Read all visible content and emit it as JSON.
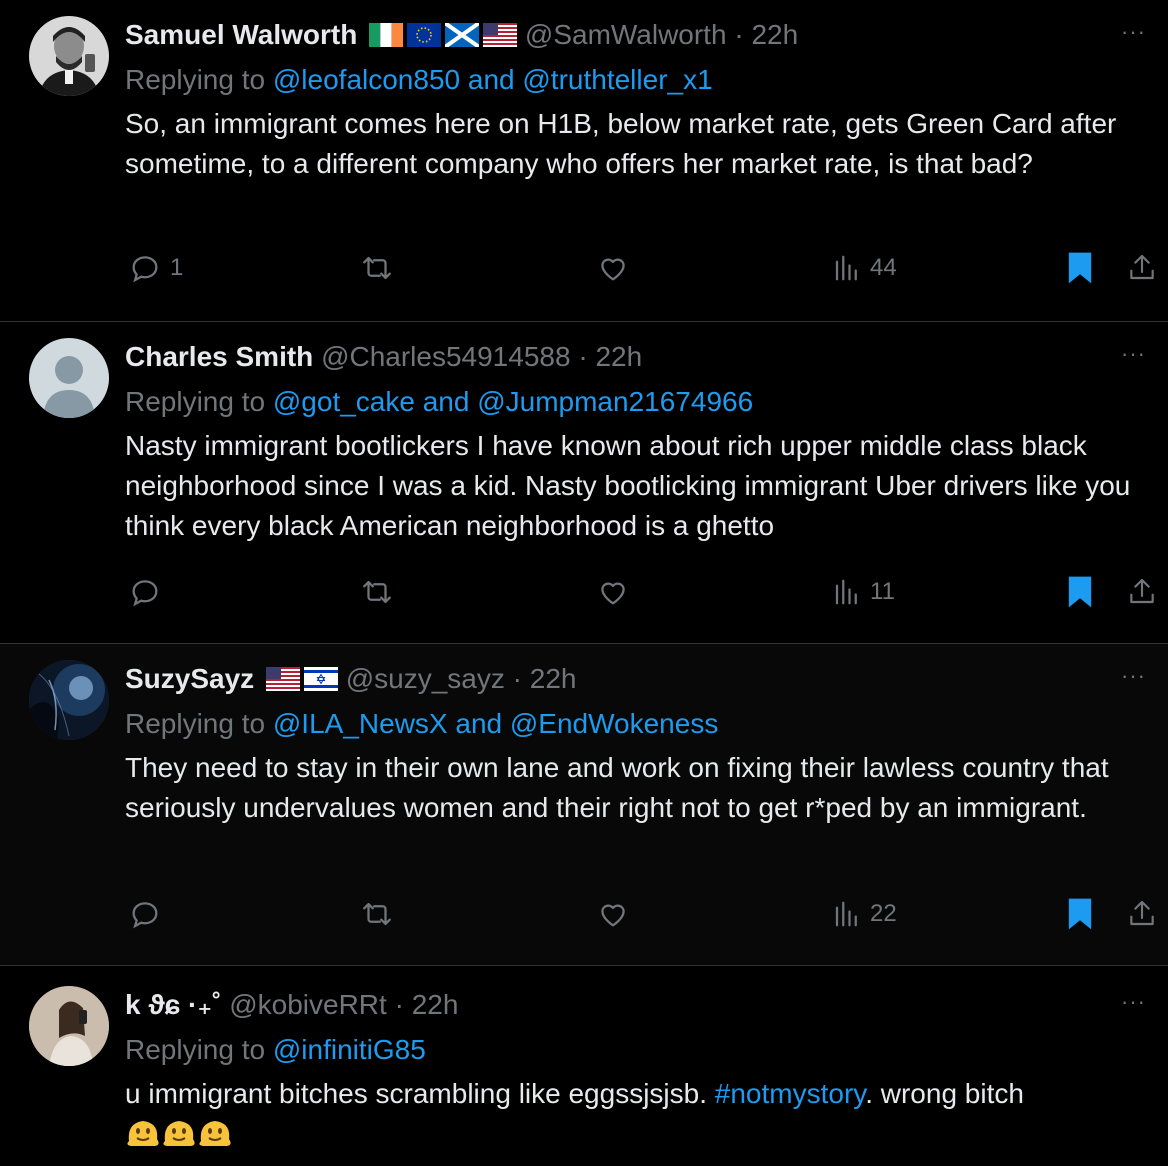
{
  "tweets": [
    {
      "name": "Samuel Walworth",
      "flags": [
        "ireland",
        "eu",
        "scotland",
        "usa"
      ],
      "handle": "@SamWalworth",
      "dot": "·",
      "time": "22h",
      "replying_prefix": "Replying to ",
      "replying_to": "@leofalcon850 and @truthteller_x1",
      "text": "So, an immigrant comes here on H1B, below market rate, gets Green Card after sometime, to a different company who offers her market rate, is that bad?",
      "reply_count": "1",
      "views": "44",
      "more": "···"
    },
    {
      "name": "Charles Smith",
      "flags": [],
      "handle": "@Charles54914588",
      "dot": "·",
      "time": "22h",
      "replying_prefix": "Replying to ",
      "replying_to": "@got_cake and @Jumpman21674966",
      "text": "Nasty immigrant bootlickers I have known about rich upper middle class black neighborhood since I was a kid. Nasty bootlicking immigrant Uber drivers like you think every black American neighborhood is a ghetto",
      "reply_count": "",
      "views": "11",
      "more": "···"
    },
    {
      "name": "SuzySayz",
      "flags": [
        "usa",
        "israel"
      ],
      "handle": "@suzy_sayz",
      "dot": "·",
      "time": "22h",
      "replying_prefix": "Replying to ",
      "replying_to": "@ILA_NewsX and @EndWokeness",
      "text": "They need to stay in their own lane and work on fixing their lawless country that seriously undervalues women and their right not to get r*ped by an immigrant.",
      "reply_count": "",
      "views": "22",
      "more": "···"
    },
    {
      "name": "k ϑɕ ·₊˚",
      "flags": [],
      "handle": "@kobiveRRt",
      "dot": "·",
      "time": "22h",
      "replying_prefix": "Replying to ",
      "replying_to": "@infinitiG85",
      "text_before": "u immigrant bitches scrambling like eggssjsjsb. ",
      "hashtag": "#notmystory",
      "text_after": ". wrong bitch",
      "emoji_count": 3,
      "more": "···"
    }
  ],
  "colors": {
    "background": "#000000",
    "text": "#e7e9ea",
    "muted": "#71767b",
    "accent": "#1d9bf0",
    "divider": "#2f3336"
  },
  "icons": [
    "reply-icon",
    "retweet-icon",
    "like-icon",
    "views-icon",
    "bookmark-icon",
    "share-icon",
    "more-icon"
  ]
}
